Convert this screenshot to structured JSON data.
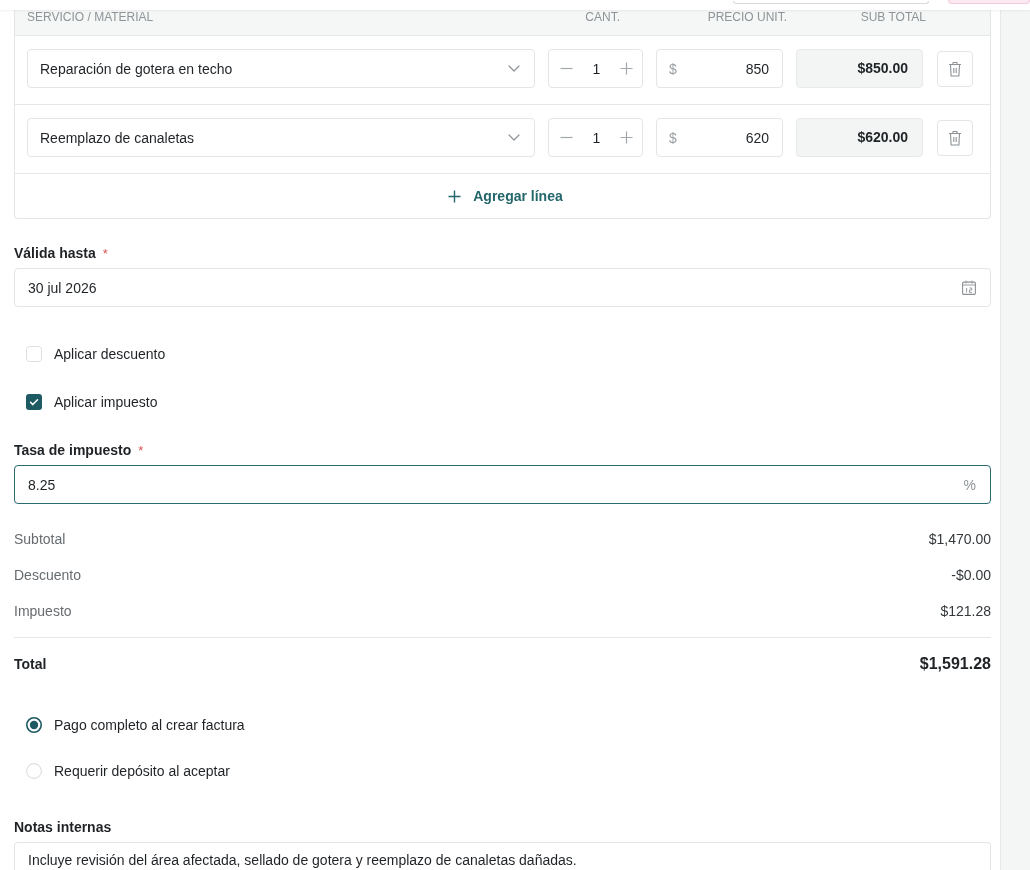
{
  "table": {
    "columns": [
      "SERVICIO / MATERIAL",
      "CANT.",
      "PRECIO UNIT.",
      "SUB TOTAL"
    ],
    "rows": [
      {
        "service": "Reparación de gotera en techo",
        "quantity": "1",
        "currency": "$",
        "unit_price": "850",
        "subtotal": "$850.00"
      },
      {
        "service": "Reemplazo de canaletas",
        "quantity": "1",
        "currency": "$",
        "unit_price": "620",
        "subtotal": "$620.00"
      }
    ],
    "add_line": "Agregar línea"
  },
  "valid_until": {
    "label": "Válida hasta",
    "required_mark": "*",
    "value": "30 jul 2026"
  },
  "options": [
    {
      "label": "Aplicar descuento",
      "checked": false
    },
    {
      "label": "Aplicar impuesto",
      "checked": true
    }
  ],
  "tax_rate": {
    "label": "Tasa de impuesto",
    "required_mark": "*",
    "value": "8.25",
    "suffix": "%",
    "focused": true
  },
  "summary": [
    {
      "label": "Subtotal",
      "value": "$1,470.00"
    },
    {
      "label": "Descuento",
      "value": "-$0.00"
    },
    {
      "label": "Impuesto",
      "value": "$121.28"
    }
  ],
  "total": {
    "label": "Total",
    "value": "$1,591.28"
  },
  "payment_options": [
    {
      "label": "Pago completo al crear factura",
      "selected": true
    },
    {
      "label": "Requerir depósito al aceptar",
      "selected": false
    }
  ],
  "notes": {
    "label": "Notas internas",
    "value": "Incluye revisión del área afectada, sellado de gotera y reemplazo de canaletas dañadas."
  }
}
